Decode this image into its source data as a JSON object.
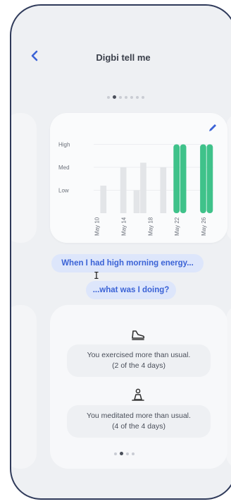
{
  "header": {
    "title": "Digbi tell me",
    "back_icon": "chevron-left-icon"
  },
  "pager_top": {
    "count": 7,
    "active": 1
  },
  "pager_bottom": {
    "count": 4,
    "active": 1
  },
  "chart_data": {
    "type": "bar",
    "categories": [
      "May 10",
      "",
      "",
      "",
      "May 14",
      "",
      "",
      "",
      "May 18",
      "",
      "",
      "",
      "May 22",
      "",
      "",
      "",
      "May 26",
      ""
    ],
    "tick_labels": [
      "May 10",
      "May 14",
      "May 18",
      "May 22",
      "May 26"
    ],
    "y_levels": [
      "High",
      "Med",
      "Low"
    ],
    "values": [
      0,
      1.2,
      0,
      0,
      2,
      0,
      1,
      2.2,
      0,
      0,
      2,
      0,
      3,
      3,
      0,
      0,
      3,
      3
    ],
    "highlight": [
      false,
      false,
      false,
      false,
      false,
      false,
      false,
      false,
      false,
      false,
      false,
      false,
      true,
      true,
      false,
      false,
      true,
      true
    ],
    "ylim": [
      0,
      3.2
    ],
    "colors": {
      "normal": "#e3e5e8",
      "highlight": "#3fc28a"
    }
  },
  "prompts": {
    "question1": "When I had high morning energy...",
    "question2": "...what was I doing?"
  },
  "insights": [
    {
      "icon": "sneaker-icon",
      "line1": "You exercised more than usual.",
      "line2": "(2 of the 4 days)"
    },
    {
      "icon": "meditation-icon",
      "line1": "You meditated more than usual.",
      "line2": "(4 of the 4 days)"
    }
  ],
  "colors": {
    "accent": "#3b63d6",
    "bubble_bg": "#dde6fb",
    "highlight_bar": "#3fc28a"
  }
}
